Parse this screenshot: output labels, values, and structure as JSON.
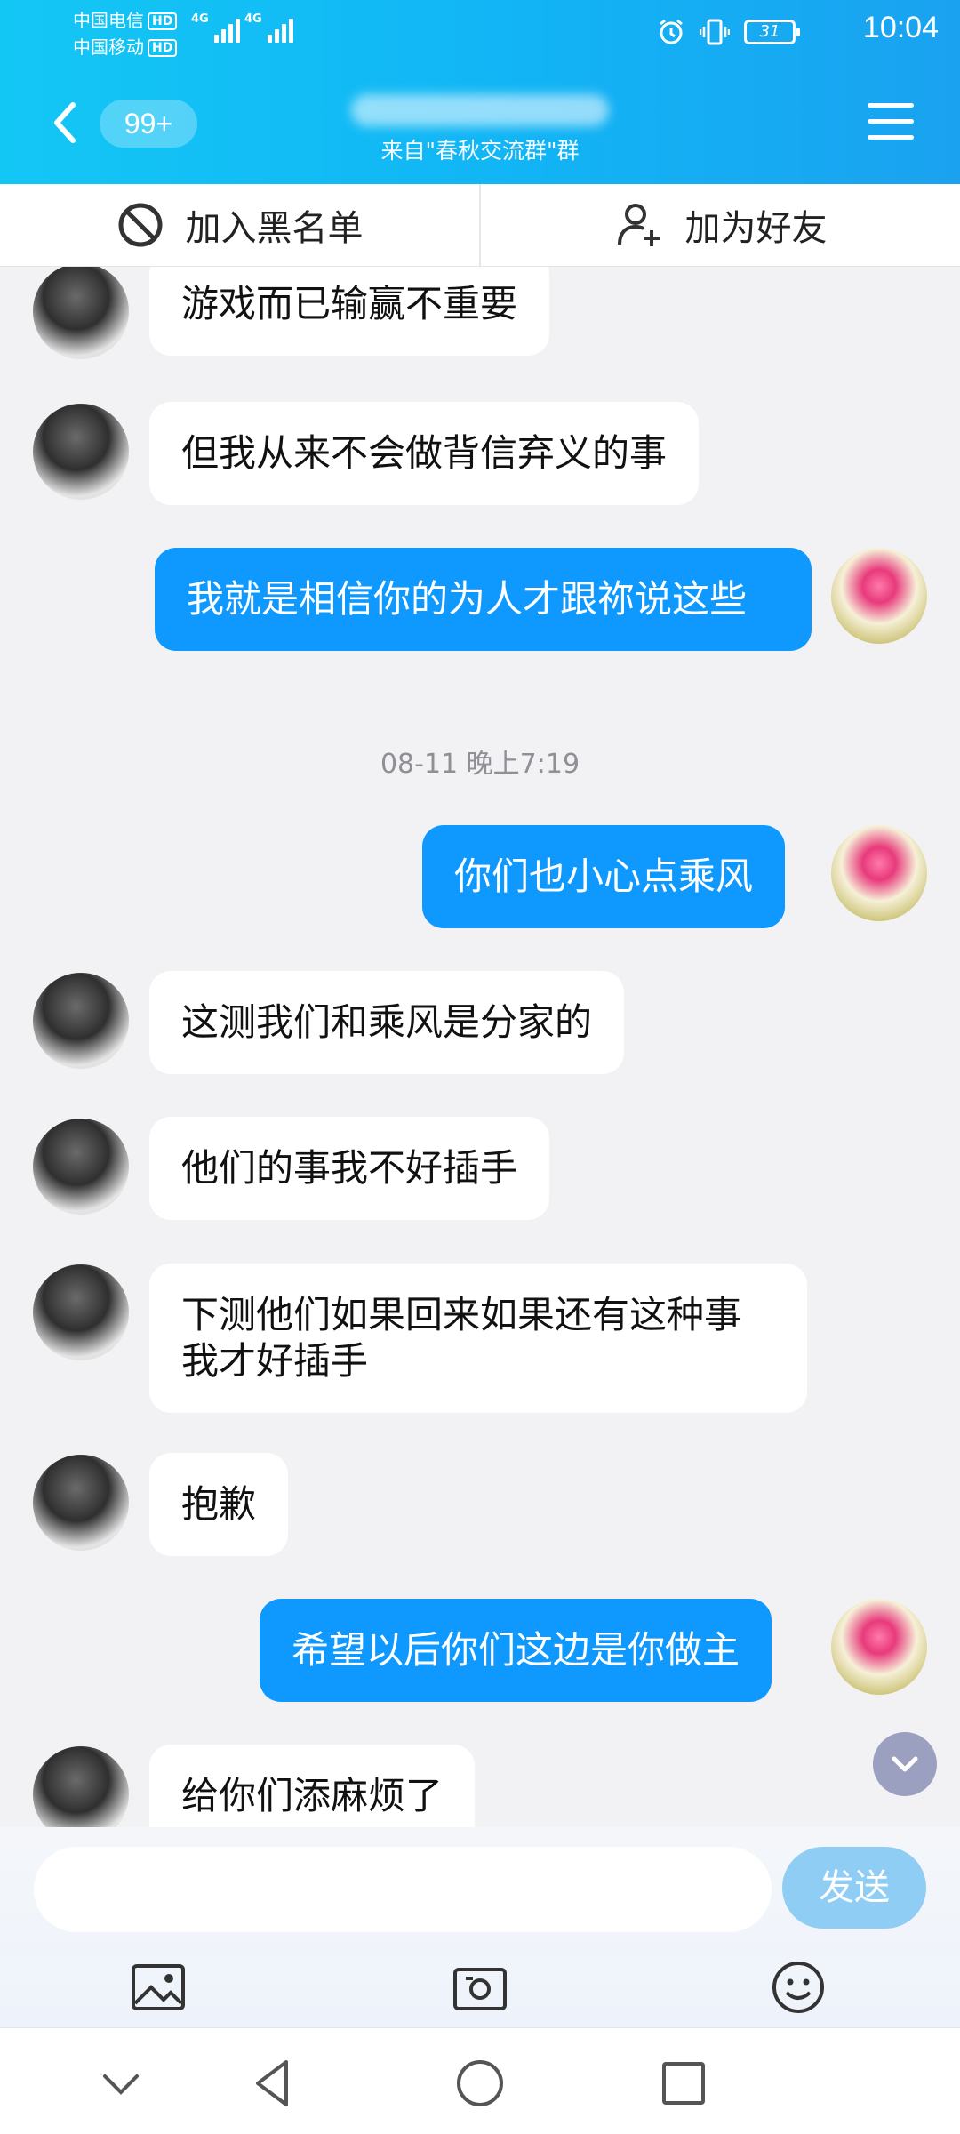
{
  "status_bar": {
    "carrier1": "中国电信",
    "carrier2": "中国移动",
    "hd_label": "HD",
    "network1": "4G",
    "network2": "4G",
    "battery": "31",
    "time": "10:04"
  },
  "header": {
    "unread_badge": "99+",
    "subtitle": "来自\"春秋交流群\"群"
  },
  "actions": {
    "block_label": "加入黑名单",
    "add_friend_label": "加为好友"
  },
  "messages": [
    {
      "side": "them",
      "text": "游戏而已输赢不重要"
    },
    {
      "side": "them",
      "text": "但我从来不会做背信弃义的事"
    },
    {
      "side": "me",
      "text": "我就是相信你的为人才跟祢说这些"
    },
    {
      "side": "me",
      "text": "你们也小心点乘风"
    },
    {
      "side": "them",
      "text": "这测我们和乘风是分家的"
    },
    {
      "side": "them",
      "text": "他们的事我不好插手"
    },
    {
      "side": "them",
      "text": "下测他们如果回来如果还有这种事我才好插手"
    },
    {
      "side": "them",
      "text": "抱歉"
    },
    {
      "side": "me",
      "text": "希望以后你们这边是你做主"
    },
    {
      "side": "them",
      "text": "给你们添麻烦了"
    }
  ],
  "timestamp": "08-11 晚上7:19",
  "input": {
    "value": "",
    "send_label": "发送"
  },
  "colors": {
    "header_start": "#13c7f5",
    "header_end": "#1aa2f0",
    "my_bubble": "#0f99ff",
    "send_button": "#8fcdf4",
    "scroll_button": "#9b9fc0"
  },
  "icons": {
    "back": "chevron-left-icon",
    "menu": "hamburger-menu-icon",
    "block": "block-icon",
    "add_friend": "add-person-icon",
    "scroll_down": "chevron-down-icon",
    "image": "image-icon",
    "camera": "camera-icon",
    "emoji": "emoji-icon",
    "nav_down": "nav-chevron-down-icon",
    "nav_back": "nav-back-icon",
    "nav_home": "nav-home-icon",
    "nav_recent": "nav-recent-icon"
  }
}
